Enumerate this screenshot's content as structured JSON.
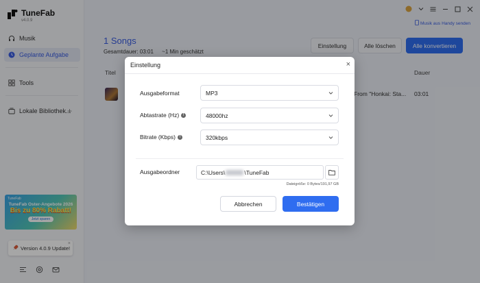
{
  "app": {
    "name": "TuneFab",
    "version": "v4.0.9"
  },
  "sidebar": {
    "items": [
      {
        "label": "Musik",
        "icon": "headphones-icon"
      },
      {
        "label": "Geplante Aufgabe",
        "icon": "clock-icon"
      },
      {
        "label": "Tools",
        "icon": "grid-icon"
      },
      {
        "label": "Lokale Bibliothek...",
        "icon": "library-icon"
      }
    ],
    "promo": {
      "brand": "TuneFab",
      "line1": "TuneFab Oster-Angebote 2026",
      "line2": "Bis zu 80% Rabatt!",
      "cta": "Jetzt sparen"
    },
    "update_label": "Version 4.0.9 Update!",
    "update_close": "×"
  },
  "header": {
    "mobile_link": "Musik aus Handy senden",
    "songs_title": "1 Songs",
    "total_duration": "Gesamtdauer: 03:01",
    "estimated": "~1 Min geschätzt",
    "buttons": {
      "settings": "Einstellung",
      "clear_all": "Alle löschen",
      "convert_all": "Alle konvertieren"
    }
  },
  "table": {
    "headers": {
      "title": "Titel",
      "duration": "Dauer"
    },
    "rows": [
      {
        "album": "From \"Honkai: Sta...",
        "duration": "03:01"
      }
    ]
  },
  "dialog": {
    "title": "Einstellung",
    "close": "×",
    "format": {
      "label": "Ausgabeformat",
      "value": "MP3"
    },
    "samplerate": {
      "label": "Abtastrate (Hz)",
      "value": "48000hz"
    },
    "bitrate": {
      "label": "Bitrate (Kbps)",
      "value": "320kbps"
    },
    "output": {
      "label": "Ausgabeordner",
      "path_prefix": "C:\\Users\\",
      "path_suffix": "\\TuneFab"
    },
    "size_info": "Dateigröße: 0 Bytes/191,97 GB",
    "cancel": "Abbrechen",
    "confirm": "Bestätigen"
  },
  "colors": {
    "accent": "#2f6df0",
    "active_nav": "#3a5de0",
    "overlay": "rgba(0,0,0,0.35)"
  }
}
